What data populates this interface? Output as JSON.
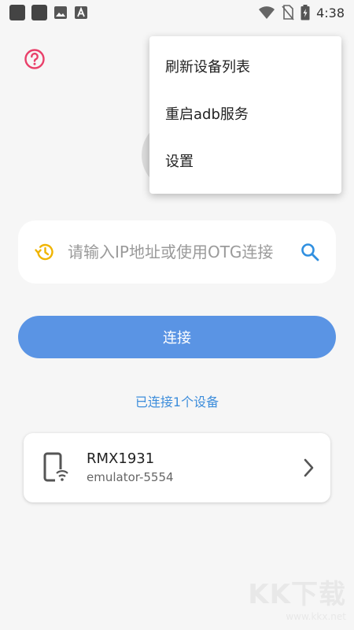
{
  "status_bar": {
    "time": "4:38",
    "left_icons": [
      "app-icon",
      "app-icon",
      "image-icon",
      "font-icon"
    ],
    "right_icons": [
      "wifi-icon",
      "no-sim-icon",
      "battery-charging-icon"
    ]
  },
  "menu": {
    "items": [
      "刷新设备列表",
      "重启adb服务",
      "设置"
    ]
  },
  "search": {
    "placeholder": "请输入IP地址或使用OTG连接",
    "history_icon": "history-icon",
    "search_icon": "search-icon"
  },
  "connect_button": {
    "label": "连接"
  },
  "connection_status": "已连接1个设备",
  "device": {
    "name": "RMX1931",
    "serial": "emulator-5554"
  },
  "watermark": {
    "logo": "KK下载",
    "url": "www.kkx.net"
  },
  "colors": {
    "accent_blue": "#5a94e4",
    "link_blue": "#3d8ddb",
    "help_red": "#e9406a",
    "history_yellow": "#f0b400"
  }
}
